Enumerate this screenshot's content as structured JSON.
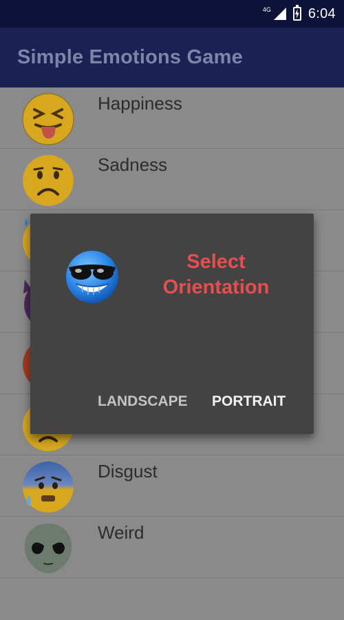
{
  "status_bar": {
    "network": "4G",
    "time": "6:04"
  },
  "app_bar": {
    "title": "Simple Emotions Game"
  },
  "emotions": [
    {
      "label": "Happiness",
      "icon": "tongue-squint-face-icon"
    },
    {
      "label": "Sadness",
      "icon": "frowning-face-icon"
    },
    {
      "label": "",
      "icon": "sweat-face-icon"
    },
    {
      "label": "",
      "icon": "devil-face-icon"
    },
    {
      "label": "",
      "icon": "angry-face-icon"
    },
    {
      "label": "",
      "icon": "disappointed-face-icon"
    },
    {
      "label": "Disgust",
      "icon": "anxious-sweat-face-icon"
    },
    {
      "label": "Weird",
      "icon": "alien-face-icon"
    }
  ],
  "dialog": {
    "title": "Select Orientation",
    "icon": "cool-sunglasses-face-icon",
    "buttons": {
      "landscape": "LANDSCAPE",
      "portrait": "PORTRAIT"
    }
  },
  "colors": {
    "status_bar": "#0c1238",
    "app_bar": "#1a2254",
    "dialog_bg": "#434343",
    "dialog_title": "#e84e4e"
  }
}
